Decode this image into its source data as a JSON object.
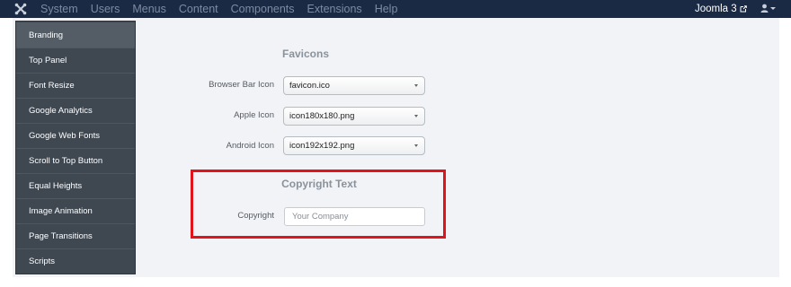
{
  "header": {
    "logo_icon": "joomla-logo-icon",
    "menu": [
      "System",
      "Users",
      "Menus",
      "Content",
      "Components",
      "Extensions",
      "Help"
    ],
    "site_link": "Joomla 3",
    "site_link_icon": "external-link-icon",
    "user_icon": "user-icon"
  },
  "sidebar": {
    "items": [
      {
        "label": "Branding",
        "active": true
      },
      {
        "label": "Top Panel"
      },
      {
        "label": "Font Resize"
      },
      {
        "label": "Google Analytics"
      },
      {
        "label": "Google Web Fonts"
      },
      {
        "label": "Scroll to Top Button"
      },
      {
        "label": "Equal Heights"
      },
      {
        "label": "Image Animation"
      },
      {
        "label": "Page Transitions"
      },
      {
        "label": "Scripts"
      }
    ]
  },
  "favicons": {
    "title": "Favicons",
    "fields": [
      {
        "label": "Browser Bar Icon",
        "value": "favicon.ico"
      },
      {
        "label": "Apple Icon",
        "value": "icon180x180.png"
      },
      {
        "label": "Android Icon",
        "value": "icon192x192.png"
      }
    ]
  },
  "copyright": {
    "title": "Copyright Text",
    "label": "Copyright",
    "placeholder": "Your Company"
  },
  "colors": {
    "topbar": "#1a2a45",
    "sidebar": "#3f4750",
    "highlight": "#e1141b"
  }
}
